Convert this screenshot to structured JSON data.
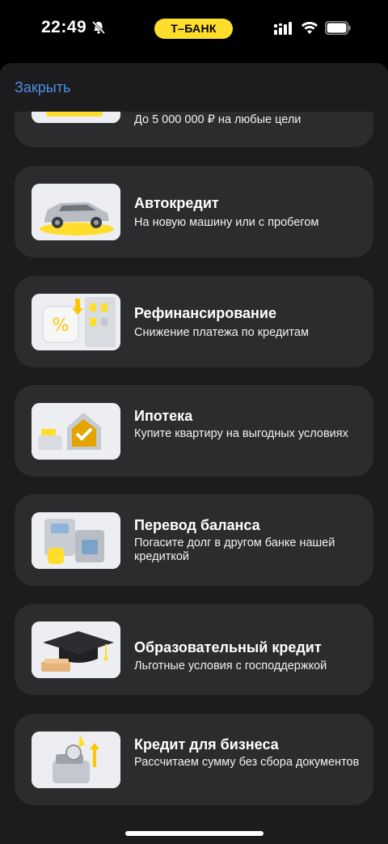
{
  "status_bar": {
    "time": "22:49",
    "brand": "Т–БАНК",
    "icons": [
      "bell-muted-icon",
      "signal-icon",
      "wifi-icon",
      "battery-icon"
    ]
  },
  "header": {
    "close_label": "Закрыть"
  },
  "colors": {
    "sheet_bg": "#1c1c1e",
    "card_bg": "#2c2c2e",
    "accent_yellow": "#ffdd2d",
    "link_blue": "#4a90e2"
  },
  "products": [
    {
      "title": "",
      "subtitle": "До 5 000 000 ₽ на любые цели",
      "icon": "cash-loan-icon"
    },
    {
      "title": "Автокредит",
      "subtitle": "На новую машину или с пробегом",
      "icon": "car-icon"
    },
    {
      "title": "Рефинансирование",
      "subtitle": "Снижение платежа по кредитам",
      "icon": "refinance-icon"
    },
    {
      "title": "Ипотека",
      "subtitle": "Купите квартиру на выгодных условиях",
      "icon": "house-icon"
    },
    {
      "title": "Перевод баланса",
      "subtitle": "Погасите долг в другом банке нашей кредиткой",
      "icon": "balance-transfer-icon"
    },
    {
      "title": "Образовательный кредит",
      "subtitle": "Льготные условия с господдержкой",
      "icon": "graduation-cap-icon"
    },
    {
      "title": "Кредит для бизнеса",
      "subtitle": "Рассчитаем сумму без сбора документов",
      "icon": "business-loan-icon"
    }
  ]
}
